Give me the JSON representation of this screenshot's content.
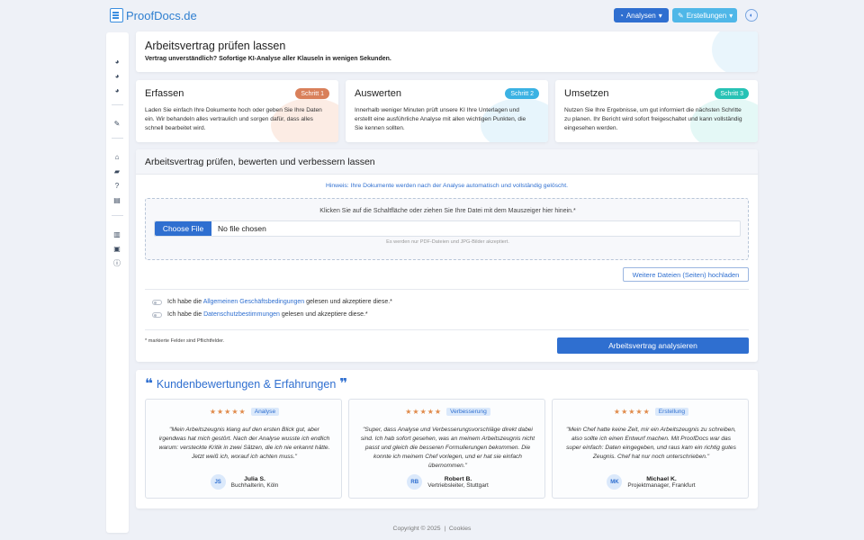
{
  "brand": {
    "name": "ProofDocs.de"
  },
  "topnav": {
    "analysen_label": "Analysen",
    "erstellungen_label": "Erstellungen"
  },
  "header": {
    "title": "Arbeitsvertrag prüfen lassen",
    "subtitle": "Vertrag unverständlich? Sofortige KI-Analyse aller Klauseln in wenigen Sekunden."
  },
  "steps": [
    {
      "title": "Erfassen",
      "badge": "Schritt 1",
      "badge_color": "#d9805a",
      "text": "Laden Sie einfach Ihre Dokumente hoch oder geben Sie Ihre Daten ein. Wir behandeln alles vertraulich und sorgen dafür, dass alles schnell bearbeitet wird."
    },
    {
      "title": "Auswerten",
      "badge": "Schritt 2",
      "badge_color": "#3bb2e3",
      "text": "Innerhalb weniger Minuten prüft unsere KI Ihre Unterlagen und erstellt eine ausführliche Analyse mit allen wichtigen Punkten, die Sie kennen sollten."
    },
    {
      "title": "Umsetzen",
      "badge": "Schritt 3",
      "badge_color": "#27c2b5",
      "text": "Nutzen Sie Ihre Ergebnisse, um gut informiert die nächsten Schritte zu planen. Ihr Bericht wird sofort freigeschaltet und kann vollständig eingesehen werden."
    }
  ],
  "upload": {
    "title": "Arbeitsvertrag prüfen, bewerten und verbessern lassen",
    "hint": "Hinweis: Ihre Dokumente werden nach der Analyse automatisch und vollständig gelöscht.",
    "drop_text": "Klicken Sie auf die Schaltfläche oder ziehen Sie Ihre Datei mit dem Mauszeiger hier hinein.*",
    "choose_label": "Choose File",
    "no_file": "No file chosen",
    "accepted": "Es werden nur PDF-Dateien und JPG-Bilder akzeptiert.",
    "more_button": "Weitere Dateien (Seiten) hochladen",
    "agb": {
      "pre": "Ich habe die",
      "link": "Allgemeinen Geschäftsbedingungen",
      "post": "gelesen und akzeptiere diese.*"
    },
    "privacy": {
      "pre": "Ich habe die",
      "link": "Datenschutzbestimmungen",
      "post": "gelesen und akzeptiere diese.*"
    },
    "required_note": "* markierte Felder sind Pflichtfelder.",
    "submit": "Arbeitsvertrag analysieren"
  },
  "reviews": {
    "title": "Kundenbewertungen & Erfahrungen",
    "items": [
      {
        "stars": "★★★★★",
        "tag": "Analyse",
        "text": "\"Mein Arbeitszeugnis klang auf den ersten Blick gut, aber irgendwas hat mich gestört. Nach der Analyse wusste ich endlich warum: versteckte Kritik in zwei Sätzen, die ich nie erkannt hätte. Jetzt weiß ich, worauf ich achten muss.\"",
        "initials": "JS",
        "name": "Julia S.",
        "role": "Buchhalterin, Köln"
      },
      {
        "stars": "★★★★★",
        "tag": "Verbesserung",
        "text": "\"Super, dass Analyse und Verbesserungsvorschläge direkt dabei sind. Ich hab sofort gesehen, was an meinem Arbeitszeugnis nicht passt und gleich die besseren Formulierungen bekommen. Die konnte ich meinem Chef vorlegen, und er hat sie einfach übernommen.\"",
        "initials": "RB",
        "name": "Robert B.",
        "role": "Vertriebsleiter, Stuttgart"
      },
      {
        "stars": "★★★★★",
        "tag": "Erstellung",
        "text": "\"Mein Chef hatte keine Zeit, mir ein Arbeitszeugnis zu schreiben, also sollte ich einen Entwurf machen. Mit ProofDocs war das super einfach: Daten eingegeben, und raus kam ein richtig gutes Zeugnis. Chef hat nur noch unterschrieben.\"",
        "initials": "MK",
        "name": "Michael K.",
        "role": "Projektmanager, Frankfurt"
      }
    ]
  },
  "footer": {
    "copyright": "Copyright © 2025",
    "separator": "|",
    "cookies": "Cookies"
  }
}
